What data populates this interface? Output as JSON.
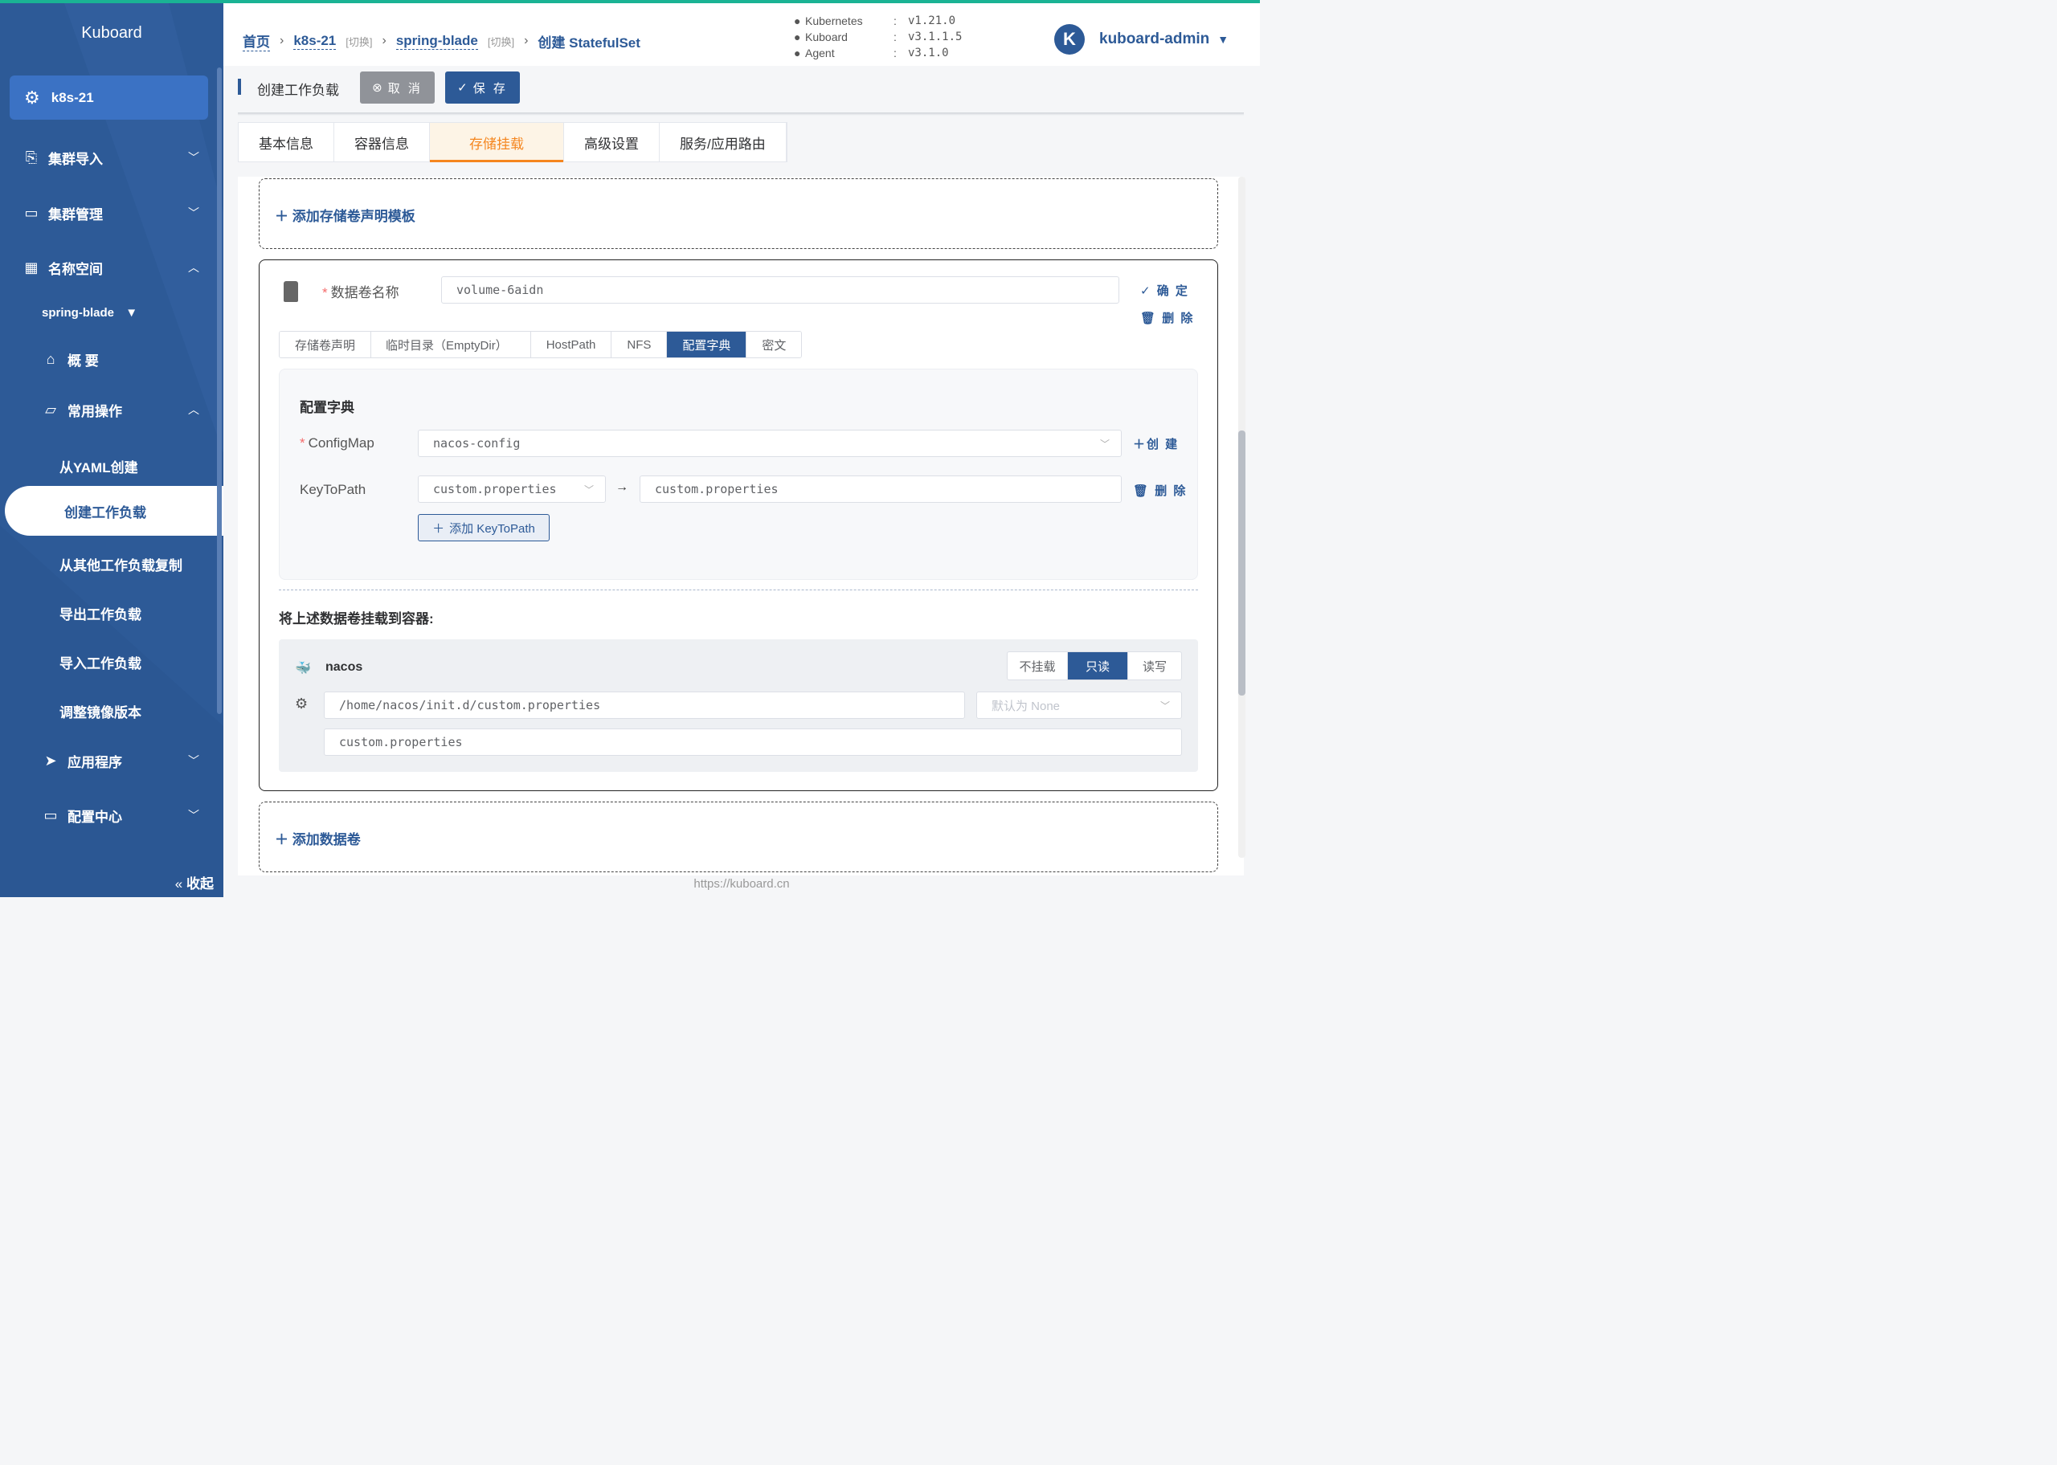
{
  "sidebar": {
    "logo": "Kuboard",
    "cluster": "k8s-21",
    "menu": {
      "cluster_import": "集群导入",
      "cluster_manage": "集群管理",
      "namespace": "名称空间",
      "namespace_value": "spring-blade",
      "overview": "概 要",
      "common_ops": "常用操作",
      "from_yaml": "从YAML创建",
      "create_workload": "创建工作负载",
      "copy_workload": "从其他工作负载复制",
      "export_workload": "导出工作负载",
      "import_workload": "导入工作负载",
      "adjust_image": "调整镜像版本",
      "apps": "应用程序",
      "config_center": "配置中心"
    },
    "collapse": "收起"
  },
  "breadcrumb": {
    "home": "首页",
    "cluster": "k8s-21",
    "cluster_switch": "[切换]",
    "namespace": "spring-blade",
    "namespace_switch": "[切换]",
    "current": "创建 StatefulSet"
  },
  "versions": [
    {
      "name": "Kubernetes",
      "value": "v1.21.0"
    },
    {
      "name": "Kuboard",
      "value": "v3.1.1.5"
    },
    {
      "name": "Agent",
      "value": "v3.1.0"
    }
  ],
  "user": {
    "avatar_letter": "K",
    "name": "kuboard-admin"
  },
  "toolbar": {
    "title": "创建工作负载",
    "cancel": "取 消",
    "save": "保 存"
  },
  "tabs": [
    "基本信息",
    "容器信息",
    "存储挂载",
    "高级设置",
    "服务/应用路由"
  ],
  "active_tab": "存储挂载",
  "add_pvc_template": "添加存储卷声明模板",
  "volume": {
    "name_label": "数据卷名称",
    "name_value": "volume-6aidn",
    "confirm": "确 定",
    "delete": "删 除",
    "types": [
      "存储卷声明",
      "临时目录（EmptyDir）",
      "HostPath",
      "NFS",
      "配置字典",
      "密文"
    ],
    "active_type": "配置字典",
    "configmap_section": {
      "title": "配置字典",
      "configmap_label": "ConfigMap",
      "configmap_value": "nacos-config",
      "create": "创 建",
      "keytopath_label": "KeyToPath",
      "key_value": "custom.properties",
      "path_value": "custom.properties",
      "delete": "删 除",
      "add_keytopath": "添加 KeyToPath"
    },
    "mount": {
      "title": "将上述数据卷挂载到容器:",
      "container": "nacos",
      "modes": [
        "不挂载",
        "只读",
        "读写"
      ],
      "active_mode": "只读",
      "mount_path": "/home/nacos/init.d/custom.properties",
      "propagation_placeholder": "默认为 None",
      "sub_path": "custom.properties"
    }
  },
  "add_volume": "添加数据卷",
  "footer": "https://kuboard.cn",
  "colors": {
    "primary": "#2d5a97",
    "accent": "#f5861f",
    "topline": "#1ab394"
  }
}
